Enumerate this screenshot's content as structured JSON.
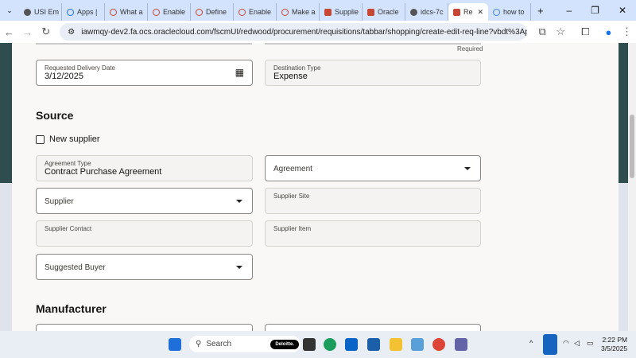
{
  "browser": {
    "tabs": [
      {
        "label": "USI Em",
        "icon": "globe-icon"
      },
      {
        "label": "Apps |",
        "icon": "apps-icon"
      },
      {
        "label": "What a",
        "icon": "oracle-icon"
      },
      {
        "label": "Enable",
        "icon": "oracle-icon"
      },
      {
        "label": "Define",
        "icon": "oracle-icon"
      },
      {
        "label": "Enable",
        "icon": "oracle-icon"
      },
      {
        "label": "Make a",
        "icon": "oracle-icon"
      },
      {
        "label": "Supplie",
        "icon": "oracle-square-icon"
      },
      {
        "label": "Oracle",
        "icon": "oracle-square-icon"
      },
      {
        "label": "idcs-7c",
        "icon": "globe-icon"
      },
      {
        "label": "Re",
        "icon": "oracle-square-icon",
        "active": true
      },
      {
        "label": "how to",
        "icon": "google-icon"
      }
    ],
    "url": "iawmqy-dev2.fa.ocs.oraclecloud.com/fscmUI/redwood/procurement/requisitions/tabbar/shopping/create-edit-req-line?vbdt%3ApreferExtension..."
  },
  "form": {
    "required": "Required",
    "requested_delivery_date": {
      "label": "Requested Delivery Date",
      "value": "3/12/2025"
    },
    "destination_type": {
      "label": "Destination Type",
      "value": "Expense"
    },
    "source_heading": "Source",
    "new_supplier": "New supplier",
    "agreement_type": {
      "label": "Agreement Type",
      "value": "Contract Purchase Agreement"
    },
    "agreement": "Agreement",
    "supplier": "Supplier",
    "supplier_site": "Supplier Site",
    "supplier_contact": "Supplier Contact",
    "supplier_item": "Supplier Item",
    "suggested_buyer": "Suggested Buyer",
    "manufacturer_heading": "Manufacturer"
  },
  "taskbar": {
    "search": "Search",
    "badge": "Deloitte.",
    "time": "2:22 PM",
    "date": "3/5/2025"
  }
}
